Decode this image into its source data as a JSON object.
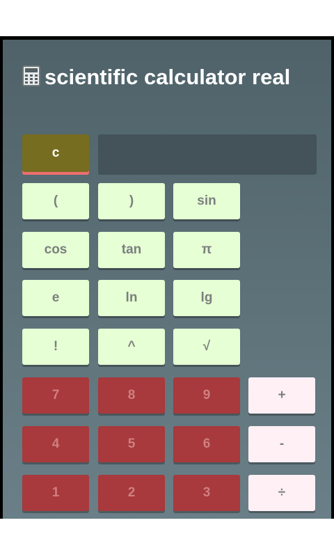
{
  "app": {
    "title": "scientific calculator real",
    "title_icon": "calculator-icon"
  },
  "display": {
    "value": ""
  },
  "keys": {
    "clear": "c",
    "lparen": "(",
    "rparen": ")",
    "sin": "sin",
    "cos": "cos",
    "tan": "tan",
    "pi": "π",
    "e": "e",
    "ln": "ln",
    "lg": "lg",
    "fact": "!",
    "pow": "^",
    "sqrt": "√",
    "d7": "7",
    "d8": "8",
    "d9": "9",
    "d4": "4",
    "d5": "5",
    "d6": "6",
    "d1": "1",
    "d2": "2",
    "d3": "3",
    "plus": "+",
    "minus": "-",
    "divide": "÷"
  },
  "colors": {
    "function_key": "#e6ffd4",
    "number_key": "#a8393c",
    "operator_key": "#fff0f5",
    "clear_key": "#766d20",
    "clear_underline": "#ee6f6f",
    "display_bg": "#44535a"
  }
}
